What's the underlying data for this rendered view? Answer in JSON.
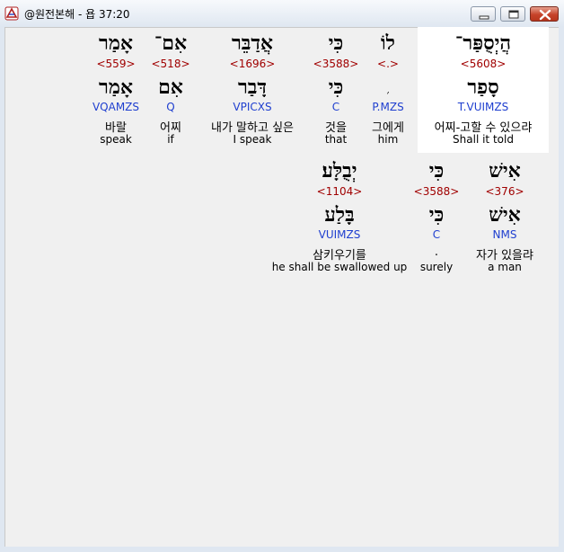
{
  "window": {
    "title": "@원전본해 - 욥 37:20",
    "icon": "app-icon",
    "controls": [
      "minimize",
      "maximize",
      "close"
    ]
  },
  "colors": {
    "strong_number": "#a00000",
    "morphology": "#1f3fcf",
    "highlight_bg": "#ffffff",
    "close_button": "#c6432a"
  },
  "rows": [
    {
      "words": [
        {
          "surface": "הֲיְסֻפַּר־",
          "strong": "<5608>",
          "lemma": "סָפַר",
          "morph": "T.VUIMZS",
          "korean": "어찌-고할 수 있으랴",
          "english": "Shall it told",
          "highlighted": true
        },
        {
          "surface": "לוֹ",
          "strong": "<.>",
          "lemma": "׳",
          "morph": "P.MZS",
          "korean": "그에게",
          "english": "him",
          "highlighted": false
        },
        {
          "surface": "כִּי",
          "strong": "<3588>",
          "lemma": "כִּי",
          "morph": "C",
          "korean": "것을",
          "english": "that",
          "highlighted": false
        },
        {
          "surface": "אֲדַבֵּר",
          "strong": "<1696>",
          "lemma": "דָּבַר",
          "morph": "VPICXS",
          "korean": "내가 말하고 싶은",
          "english": "I speak",
          "highlighted": false
        },
        {
          "surface": "אִם־",
          "strong": "<518>",
          "lemma": "אִם",
          "morph": "Q",
          "korean": "어찌",
          "english": "if",
          "highlighted": false
        },
        {
          "surface": "אָמַר",
          "strong": "<559>",
          "lemma": "אָמַר",
          "morph": "VQAMZS",
          "korean": "바랄",
          "english": "speak",
          "highlighted": false
        }
      ]
    },
    {
      "words": [
        {
          "surface": "אִישׁ",
          "strong": "<376>",
          "lemma": "אִישׁ",
          "morph": "NMS",
          "korean": "자가 있을랴",
          "english": "a man",
          "highlighted": false
        },
        {
          "surface": "כִּי",
          "strong": "<3588>",
          "lemma": "כִּי",
          "morph": "C",
          "korean": ".",
          "english": "surely",
          "highlighted": false
        },
        {
          "surface": "יְבֻלָּע׃",
          "strong": "<1104>",
          "lemma": "בָּלַע",
          "morph": "VUIMZS",
          "korean": "삼키우기를",
          "english": "he shall be swallowed up",
          "highlighted": false
        }
      ]
    }
  ]
}
